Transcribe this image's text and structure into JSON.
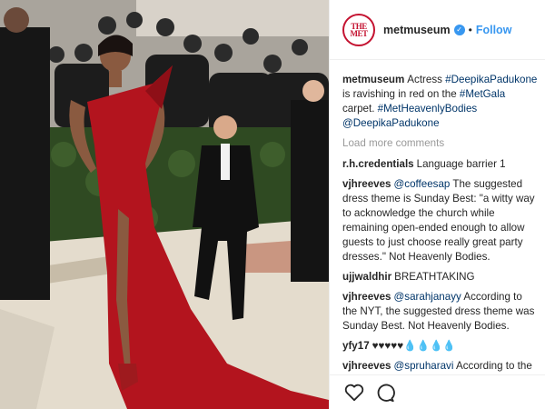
{
  "photo": {
    "alt_icon": "met-gala-photo"
  },
  "header": {
    "logo_line1": "THE",
    "logo_line2": "MET",
    "username": "metmuseum",
    "separator": "•",
    "follow_label": "Follow"
  },
  "caption": {
    "user": "metmuseum",
    "parts": [
      "Actress ",
      "#DeepikaPadukone",
      " is ravishing in red on the ",
      "#MetGala",
      " carpet. ",
      "#MetHeavenlyBodies",
      " ",
      "@DeepikaPadukone"
    ]
  },
  "load_more": "Load more comments",
  "comments": [
    {
      "user": "r.h.credentials",
      "mention": "",
      "text": "Language barrier 1"
    },
    {
      "user": "vjhreeves",
      "mention": "@coffeesap",
      "text": " The suggested dress theme is Sunday Best: \"a witty way to acknowledge the church while remaining open-ended enough to allow guests to just choose really great party dresses.\" Not Heavenly Bodies."
    },
    {
      "user": "ujjwaldhir",
      "mention": "",
      "text": "BREATHTAKING"
    },
    {
      "user": "vjhreeves",
      "mention": "@sarahjanayy",
      "text": " According to the NYT, the suggested dress theme was Sunday Best. Not Heavenly Bodies."
    },
    {
      "user": "yfy17",
      "mention": "",
      "text": "♥♥♥♥♥💧💧💧💧"
    },
    {
      "user": "vjhreeves",
      "mention": "@spruharavi",
      "text": " According to the NYT, the optional dress code theme was"
    }
  ],
  "actions": {
    "like_icon": "heart-icon",
    "comment_icon": "comment-icon"
  }
}
